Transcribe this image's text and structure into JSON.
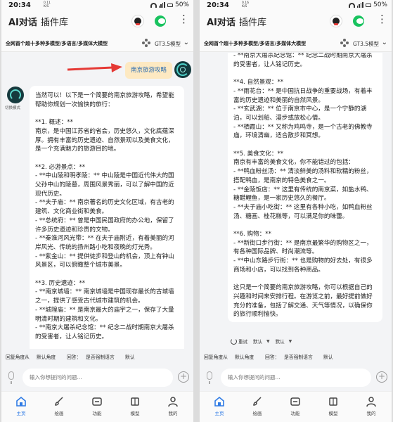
{
  "status": {
    "time": "20:34",
    "speed_left": "0.11\nK/S",
    "speed_right": "0.16\nK/S",
    "signal": "4G",
    "battery": "50%"
  },
  "header": {
    "tab_chat": "AI对话",
    "tab_plugins": "插件库"
  },
  "subbar": {
    "slogan": "全网首个超十多种多模型/多语言/多媒体大模型",
    "model": "GT3.5模型"
  },
  "chat": {
    "user_message": "南京旅游攻略",
    "ai_mode_label": "切换模式",
    "left_text": "当然可以！以下是一个简要的南京旅游攻略，希望能帮助你规划一次愉快的旅行：\n\n**1. 概述：**\n南京，是中国江苏省的省会，历史悠久，文化底蕴深厚。拥有丰富的历史遗迹、自然景观以及美食文化，是一个充满魅力的旅游目的地。\n\n**2. 必游景点：**\n- **中山陵和明孝陵：** 中山陵是中国近代伟大的国父孙中山的陵墓，周围风景秀丽，可以了解中国的近现代历史。\n- **夫子庙：** 南京著名的历史文化区域，有古老的建筑、文化商业街和美食。\n- **总统府：** 曾是中国民国政府的办公地，保留了许多历史遗迹和珍贵的文物。\n- **秦淮河风光带：** 在夫子庙附近，有着美丽的河岸风光、传统的扬州路小吃和夜晚的灯光秀。\n- **紫金山：** 提供徒步和登山的机会，顶上有钟山风景区，可以俯瞰整个城市美景。\n\n**3. 历史遗迹：**\n- **南京城墙：** 南京城墙是中国现存最长的古城墙之一，提供了感受古代城市建筑的机会。\n- **城隍庙：** 是南京最大的庙宇之一，保存了大量明清时期的建筑和文化。\n- **南京大屠杀纪念馆：** 纪念二战时期南京大屠杀的受害者，让人铭记历史。\n\n**4. 自然景观：**",
    "right_text": "- **南京大屠杀纪念馆：** 纪念二战时期南京大屠杀的受害者，让人铭记历史。\n\n**4. 自然景观：**\n- **雨花台：** 是中国抗日战争的重要战场，有着丰富的历史遗迹和美丽的自然风景。\n- **玄武湖：** 位于南京市中心，是一个宁静的湖泊，可以划船、漫步或放松心情。\n- **栖霞山：** 又称为鸡鸣寺，是一个古老的佛教寺庙，环境清幽，适合散步和冥想。\n\n**5. 美食文化：**\n南京有丰富的美食文化，你不能错过的包括：\n- **鸭血粉丝汤：** 清淡鲜美的汤料和软糯的粉丝，搭配鸭血，是南京的特色美食之一。\n- **金陵饭店：** 这里有传统的南京菜，如盐水鸭、糖醋鲤鱼，是一家历史悠久的餐厅。\n- **夫子庙小吃街：** 这里有各种小吃，如鸭血粉丝汤、糖画、桂花糕等，可以满足你的味蕾。\n\n**6. 购物：**\n- **新街口步行街：** 是南京最繁华的购物区之一，有各种国际品牌、时尚潮流等。\n- **中山东路步行街：** 也是购物的好去处，有很多商场和小店，可以找到各种商品。\n\n这只是一个简要的南京旅游攻略，你可以根据自己的兴趣和时间来安排行程。在游览之前，最好提前做好充分的准备，包括了解交通、天气等情况，以确保你的旅行顺利愉快。",
    "actions": {
      "retry": "重试",
      "default1": "默认",
      "default2": "默认"
    }
  },
  "quickbar": {
    "reply_angle": "回复角度从",
    "default_angle": "默认角度",
    "reply": "回答：",
    "force_lang": "是否强制语言",
    "default": "默认"
  },
  "input": {
    "placeholder": "输入你想提问的问题..."
  },
  "tabbar": [
    {
      "label": "主页"
    },
    {
      "label": "绘画"
    },
    {
      "label": "功能"
    },
    {
      "label": "模型"
    },
    {
      "label": "我的"
    }
  ],
  "colors": {
    "accent": "#2f7be5",
    "user_bubble": "#fde9c2",
    "arrow": "#e53935"
  }
}
